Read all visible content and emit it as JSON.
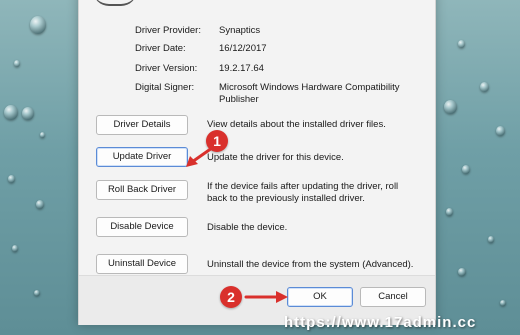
{
  "properties": [
    {
      "label": "Driver Provider:",
      "value": "Synaptics"
    },
    {
      "label": "Driver Date:",
      "value": "16/12/2017"
    },
    {
      "label": "Driver Version:",
      "value": "19.2.17.64"
    },
    {
      "label": "Digital Signer:",
      "value": "Microsoft Windows Hardware Compatibility Publisher"
    }
  ],
  "actions": [
    {
      "button": "Driver Details",
      "description": "View details about the installed driver files."
    },
    {
      "button": "Update Driver",
      "description": "Update the driver for this device."
    },
    {
      "button": "Roll Back Driver",
      "description": "If the device fails after updating the driver, roll back to the previously installed driver."
    },
    {
      "button": "Disable Device",
      "description": "Disable the device."
    },
    {
      "button": "Uninstall Device",
      "description": "Uninstall the device from the system (Advanced)."
    }
  ],
  "footer": {
    "ok_label": "OK",
    "cancel_label": "Cancel"
  },
  "annotations": {
    "badge_1": "1",
    "badge_2": "2",
    "color": "#d9302c"
  },
  "watermark": "https://www.17admin.cc"
}
